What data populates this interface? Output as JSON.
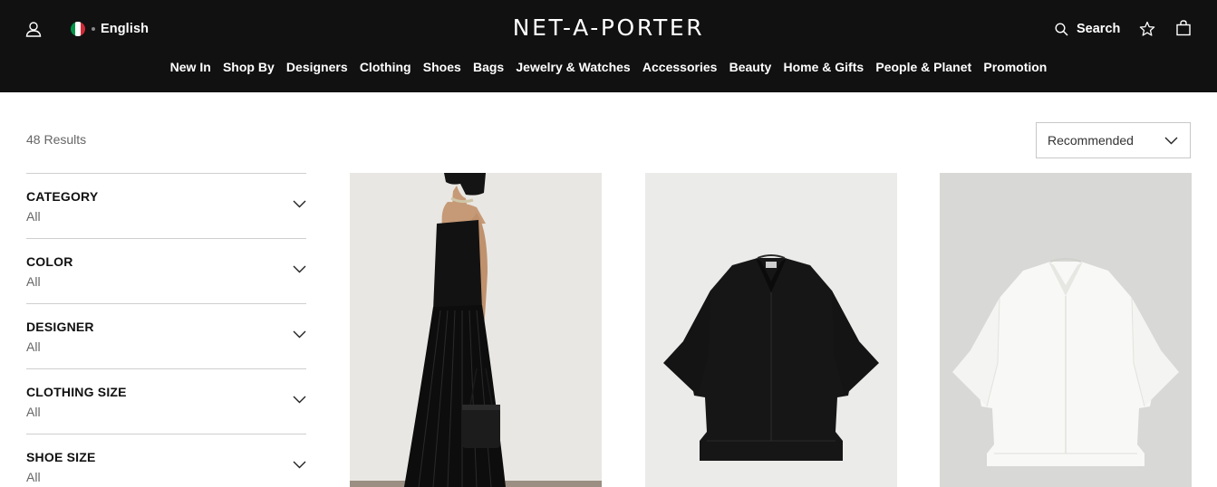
{
  "header": {
    "logo": "NET-A-PORTER",
    "language": "English",
    "search_label": "Search",
    "flag_colors": [
      "#009246",
      "#ffffff",
      "#ce2b37"
    ],
    "icons": [
      "user-icon",
      "search-icon",
      "star-icon",
      "bag-icon"
    ]
  },
  "nav": {
    "items": [
      {
        "label": "New In"
      },
      {
        "label": "Shop By"
      },
      {
        "label": "Designers"
      },
      {
        "label": "Clothing"
      },
      {
        "label": "Shoes"
      },
      {
        "label": "Bags"
      },
      {
        "label": "Jewelry & Watches"
      },
      {
        "label": "Accessories"
      },
      {
        "label": "Beauty"
      },
      {
        "label": "Home & Gifts"
      },
      {
        "label": "People & Planet"
      },
      {
        "label": "Promotion"
      }
    ]
  },
  "listing": {
    "results": "48 Results",
    "sort_label": "Recommended"
  },
  "filters": [
    {
      "title": "CATEGORY",
      "value": "All"
    },
    {
      "title": "COLOR",
      "value": "All"
    },
    {
      "title": "DESIGNER",
      "value": "All"
    },
    {
      "title": "CLOTHING SIZE",
      "value": "All"
    },
    {
      "title": "SHOE SIZE",
      "value": "All"
    }
  ],
  "products": [
    {
      "image": "model-black-strapless-pleated-dress"
    },
    {
      "image": "black-short-sleeve-shirt"
    },
    {
      "image": "white-short-sleeve-shirt"
    }
  ],
  "colors": {
    "header_bg": "#111111",
    "accent": "#ffffff"
  }
}
